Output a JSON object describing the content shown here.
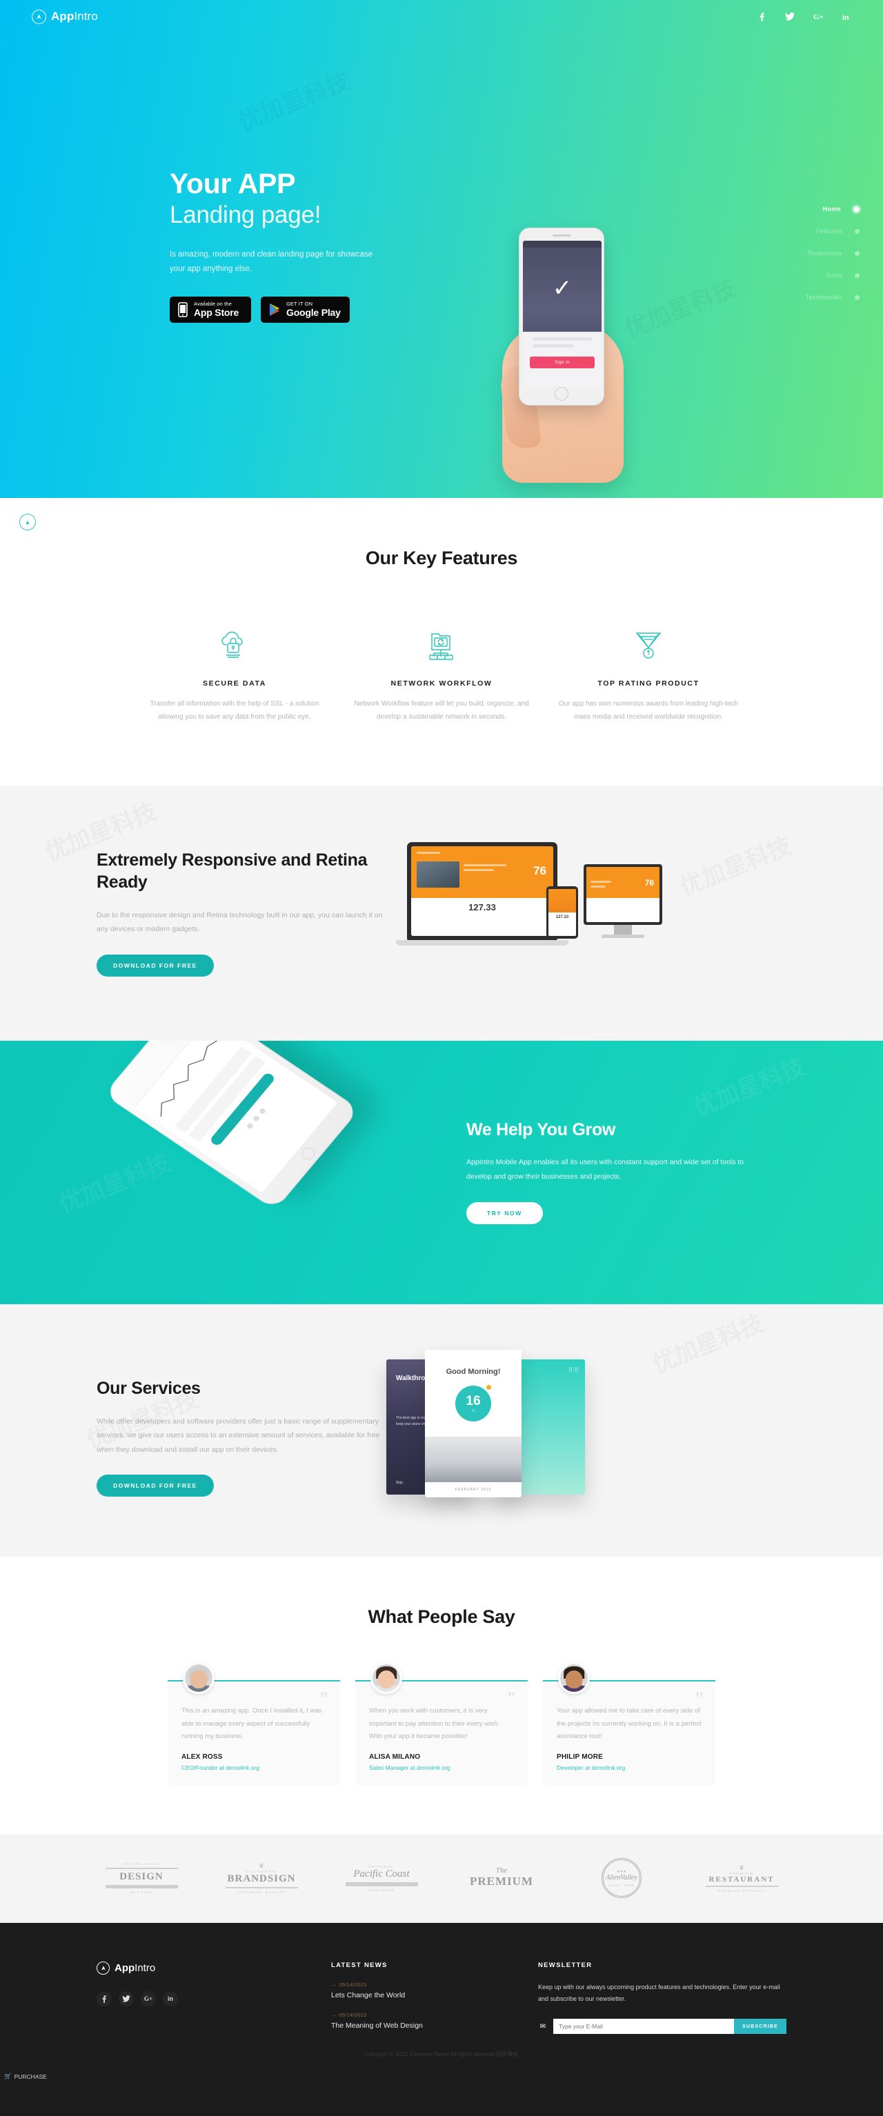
{
  "brand": {
    "bold": "App",
    "light": "Intro"
  },
  "header": {
    "social": [
      {
        "name": "facebook-icon",
        "glyph": "f"
      },
      {
        "name": "twitter-icon",
        "glyph": "t"
      },
      {
        "name": "google-plus-icon",
        "glyph": "G+"
      },
      {
        "name": "linkedin-icon",
        "glyph": "in"
      }
    ]
  },
  "hero": {
    "title": "Your APP",
    "subtitle": "Landing page!",
    "description": "Is amazing, modern and clean landing page for showcase your app anything else.",
    "app_store": {
      "small": "Available on the",
      "big": "App Store"
    },
    "google_play": {
      "small": "GET IT ON",
      "big": "Google Play"
    },
    "phone": {
      "button_label": "Sign in"
    },
    "nav": [
      {
        "label": "Home",
        "active": true
      },
      {
        "label": "Features",
        "active": false
      },
      {
        "label": "Responsive",
        "active": false
      },
      {
        "label": "Grow",
        "active": false
      },
      {
        "label": "Testimonials",
        "active": false
      }
    ],
    "scroll_icon": "chevron-up-icon"
  },
  "features": {
    "title": "Our Key Features",
    "items": [
      {
        "icon": "cloud-lock-icon",
        "name": "SECURE DATA",
        "desc": "Transfer all information with the help of SSL - a solution allowing you to save any data from the public eye."
      },
      {
        "icon": "network-workflow-icon",
        "name": "NETWORK WORKFLOW",
        "desc": "Network Workflow feature will let you build, organize, and develop a sustainable network in seconds."
      },
      {
        "icon": "award-medal-icon",
        "name": "TOP RATING PRODUCT",
        "desc": "Our app has won numerous awards from leading high-tech mass media and received worldwide recognition."
      }
    ]
  },
  "responsive": {
    "title": "Extremely Responsive and Retina Ready",
    "desc": "Due to the responsive design and Retina technology built in our app, you can launch it on any devices or modern gadgets.",
    "button": "DOWNLOAD FOR FREE",
    "mock": {
      "laptop_value": "76",
      "laptop_big": "127.33",
      "monitor_value": "76",
      "tablet_value": "127.33"
    }
  },
  "grow": {
    "title": "We Help You Grow",
    "desc": "AppIntro Mobile App enables all its users with constant support and wide set of tools to develop and grow their businesses and projects.",
    "button": "TRY NOW"
  },
  "services": {
    "title": "Our Services",
    "desc": "While other developers and software providers offer just a basic range of supplementary services, we give our users access to an extensive amount of services, available for free when they download and install our app on their devices.",
    "button": "DOWNLOAD FOR FREE",
    "cards": {
      "back_left_title": "Walkthrough",
      "back_left_text": "The best app to organize your day and keep your plans on track.",
      "back_left_skip": "Skip",
      "front_title": "Good Morning!",
      "front_number": "16",
      "front_unit": "°C",
      "front_date": "FEBRUARY 2016"
    }
  },
  "testimonials": {
    "title": "What People Say",
    "items": [
      {
        "text": "This is an amazing app. Once I installed it, I was able to manage every aspect of successfully running my business.",
        "name": "ALEX ROSS",
        "role": "CEO/Founder at demolink.org",
        "avatar": "avatar-alex-ross",
        "skin": "#e8bd9d",
        "hair": "#cfcfcf",
        "body": "#6f7a8a"
      },
      {
        "text": "When you work with customers, it is very important to pay attention to their every wish. With your app it became possible!",
        "name": "ALISA MILANO",
        "role": "Sales Manager at demolink.org",
        "avatar": "avatar-alisa-milano",
        "skin": "#f0c7a8",
        "hair": "#3b2b22",
        "body": "#e6e6e6"
      },
      {
        "text": "Your app allowed me to take care of every side of the projects Im currently working on. It is a perfect assistance tool!",
        "name": "PHILIP MORE",
        "role": "Developer at demolink.org",
        "avatar": "avatar-philip-more",
        "skin": "#c98a5e",
        "hair": "#2a1c16",
        "body": "#4c3a6d"
      }
    ],
    "quote_glyph": "”"
  },
  "partners": [
    {
      "top": "ESTABLISHED",
      "main": "DESIGN",
      "sub": "EST 1984",
      "style": "plain"
    },
    {
      "top": "CALIFORNIA",
      "main": "BRANDSIGN",
      "sub": "HANDMADE QUALITY",
      "style": "crown"
    },
    {
      "top": "ORIGINAL",
      "main": "Pacific Coast",
      "sub": "SURFWEAR",
      "style": "script"
    },
    {
      "top": "The",
      "main": "PREMIUM",
      "sub": "",
      "style": "premium"
    },
    {
      "top": "",
      "main": "AlienValley",
      "sub": "Since 1989",
      "style": "badge"
    },
    {
      "top": "PREMIUM",
      "main": "RESTAURANT",
      "sub": "PREMIUM PRODUCT",
      "style": "crown"
    }
  ],
  "footer": {
    "social": [
      {
        "name": "facebook-icon",
        "glyph": "f"
      },
      {
        "name": "twitter-icon",
        "glyph": "t"
      },
      {
        "name": "google-plus-icon",
        "glyph": "G+"
      },
      {
        "name": "linkedin-icon",
        "glyph": "in"
      }
    ],
    "news_heading": "LATEST NEWS",
    "news": [
      {
        "date": "05/14/2015",
        "title": "Lets Change the World"
      },
      {
        "date": "05/14/2015",
        "title": "The Meaning of Web Design"
      }
    ],
    "newsletter_heading": "NEWSLETTER",
    "newsletter_text": "Keep up with our always upcoming product features and technologies. Enter your e-mail and subscribe to our newsletter.",
    "email_placeholder": "Type your E-Mail",
    "email_value": "",
    "subscribe_label": "SUBSCRIBE",
    "copyright": "Copyright © 2021 Company Name All rights reserved.网页模板",
    "purchase_label": "PURCHASE"
  },
  "colors": {
    "teal": "#16b3ae",
    "cyan": "#00c0f3",
    "green": "#69e583",
    "accent_blue": "#2bb8c4",
    "dark": "#1c1c1c"
  }
}
